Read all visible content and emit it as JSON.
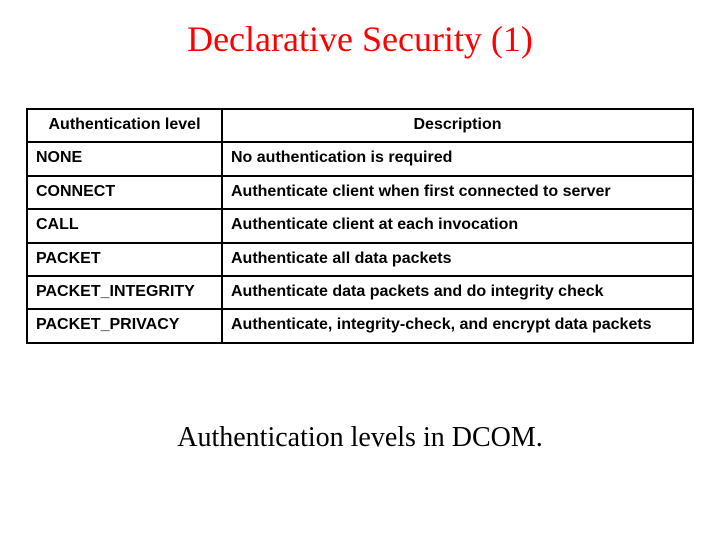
{
  "title": "Declarative Security (1)",
  "table": {
    "headers": {
      "level": "Authentication level",
      "description": "Description"
    },
    "rows": [
      {
        "level": "NONE",
        "description": "No authentication is required"
      },
      {
        "level": "CONNECT",
        "description": "Authenticate client when first connected to server"
      },
      {
        "level": "CALL",
        "description": "Authenticate client at each invocation"
      },
      {
        "level": "PACKET",
        "description": "Authenticate all data packets"
      },
      {
        "level": "PACKET_INTEGRITY",
        "description": "Authenticate data packets and do integrity check"
      },
      {
        "level": "PACKET_PRIVACY",
        "description": "Authenticate, integrity-check, and encrypt data packets"
      }
    ]
  },
  "caption": "Authentication levels in DCOM."
}
